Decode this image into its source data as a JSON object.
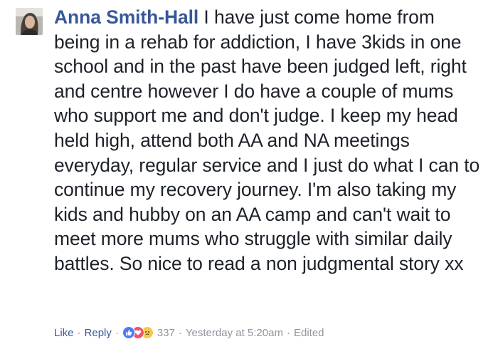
{
  "comment": {
    "author": "Anna Smith-Hall",
    "text": " I have just come home from being in a rehab for addiction, I have 3kids in one school and in the past have been judged left, right and centre however I do have a couple of mums who support me and don't judge. I keep my head held high, attend both AA and NA meetings everyday, regular service and I just do what I can to continue my recovery journey. I'm also taking my kids and hubby on an AA camp and can't wait to meet more mums who struggle with similar daily battles. So nice to read a non judgmental story xx"
  },
  "actions": {
    "like_label": "Like",
    "reply_label": "Reply",
    "separator": "·",
    "reaction_count": "337",
    "timestamp": "Yesterday at 5:20am",
    "edited_label": "Edited"
  },
  "reactions": [
    "like-icon",
    "love-icon",
    "sad-icon"
  ],
  "colors": {
    "author_link": "#385898",
    "body_text": "#1d2129",
    "meta_text": "#90949c",
    "like": "#4a7cf5",
    "love": "#f25268",
    "sad": "#f7c94a"
  }
}
